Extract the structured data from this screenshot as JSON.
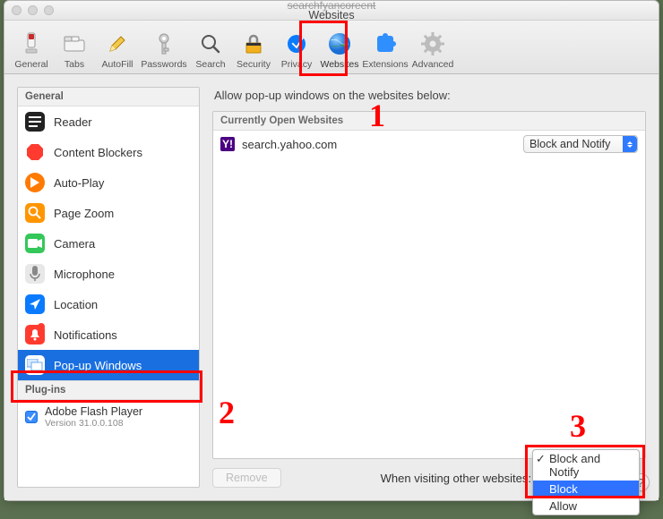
{
  "window": {
    "subtitle_truncated": "searchfyancoreent",
    "title": "Websites"
  },
  "toolbar": [
    {
      "id": "general",
      "label": "General"
    },
    {
      "id": "tabs",
      "label": "Tabs"
    },
    {
      "id": "autofill",
      "label": "AutoFill"
    },
    {
      "id": "passwords",
      "label": "Passwords"
    },
    {
      "id": "search",
      "label": "Search"
    },
    {
      "id": "security",
      "label": "Security"
    },
    {
      "id": "privacy",
      "label": "Privacy"
    },
    {
      "id": "websites",
      "label": "Websites",
      "selected": true
    },
    {
      "id": "extensions",
      "label": "Extensions"
    },
    {
      "id": "advanced",
      "label": "Advanced"
    }
  ],
  "sidebar": {
    "general_header": "General",
    "items": [
      {
        "id": "reader",
        "label": "Reader"
      },
      {
        "id": "content-blockers",
        "label": "Content Blockers"
      },
      {
        "id": "auto-play",
        "label": "Auto-Play"
      },
      {
        "id": "page-zoom",
        "label": "Page Zoom"
      },
      {
        "id": "camera",
        "label": "Camera"
      },
      {
        "id": "microphone",
        "label": "Microphone"
      },
      {
        "id": "location",
        "label": "Location"
      },
      {
        "id": "notifications",
        "label": "Notifications",
        "badge": true
      },
      {
        "id": "popups",
        "label": "Pop-up Windows",
        "selected": true
      }
    ],
    "plugins_header": "Plug-ins",
    "plugin": {
      "name": "Adobe Flash Player",
      "version": "Version 31.0.0.108",
      "checked": true
    }
  },
  "right": {
    "caption": "Allow pop-up windows on the websites below:",
    "list_header": "Currently Open Websites",
    "rows": [
      {
        "site": "search.yahoo.com",
        "setting": "Block and Notify"
      }
    ],
    "remove_label": "Remove",
    "footer_label": "When visiting other websites:",
    "dropdown": {
      "options": [
        "Block and Notify",
        "Block",
        "Allow"
      ],
      "checked": "Block and Notify",
      "highlighted": "Block"
    }
  },
  "annotations": {
    "n1": "1",
    "n2": "2",
    "n3": "3"
  }
}
